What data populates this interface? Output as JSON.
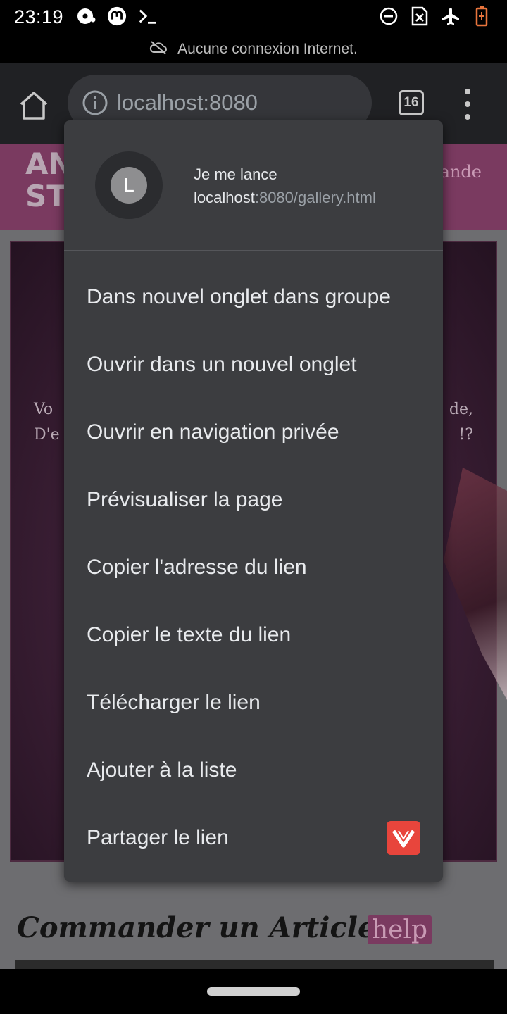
{
  "status_bar": {
    "time": "23:19",
    "left_icons": [
      "media-icon",
      "mastodon-icon",
      "terminal-icon"
    ],
    "right_icons": [
      "do-not-disturb-icon",
      "no-sim-icon",
      "airplane-icon",
      "battery-low-icon"
    ]
  },
  "offline_banner": {
    "text": "Aucune connexion Internet."
  },
  "toolbar": {
    "url_host": "localhost:8080",
    "tab_count": "16"
  },
  "page": {
    "logo_line1": "AN",
    "logo_line2": "ST",
    "nav_link": "ande",
    "hero_left_line1": "Vo",
    "hero_left_line2": "D'e",
    "hero_right_line1": "de,",
    "hero_right_line2": "!?",
    "title": "Commander un Article",
    "help": "help"
  },
  "context_menu": {
    "avatar_letter": "L",
    "link_title": "Je me lance",
    "link_host": "localhost",
    "link_path": ":8080/gallery.html",
    "items": [
      {
        "label": "Dans nouvel onglet dans groupe"
      },
      {
        "label": "Ouvrir dans un nouvel onglet"
      },
      {
        "label": "Ouvrir en navigation privée"
      },
      {
        "label": "Prévisualiser la page"
      },
      {
        "label": "Copier l'adresse du lien"
      },
      {
        "label": "Copier le texte du lien"
      },
      {
        "label": "Télécharger le lien"
      },
      {
        "label": "Ajouter à la liste"
      },
      {
        "label": "Partager le lien"
      }
    ],
    "share_app_icon": "vidmate-icon"
  },
  "colors": {
    "menu_bg": "#3c3d40",
    "toolbar_bg": "#202124",
    "page_accent": "#7a3a60",
    "share_icon_bg": "#e8453c"
  }
}
